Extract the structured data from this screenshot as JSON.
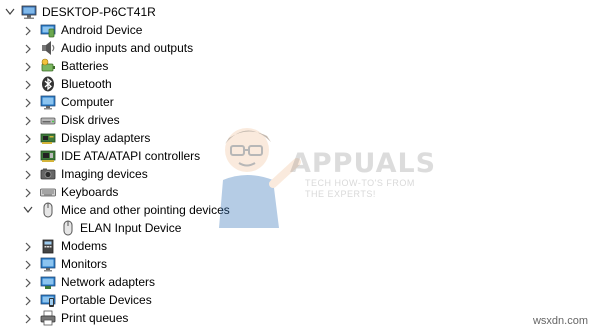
{
  "tree": {
    "root": {
      "label": "DESKTOP-P6CT41R",
      "icon": "computer-root-icon",
      "expanded": true
    },
    "items": [
      {
        "label": "Android Device",
        "icon": "android-device-icon",
        "expanded": false
      },
      {
        "label": "Audio inputs and outputs",
        "icon": "speaker-icon",
        "expanded": false
      },
      {
        "label": "Batteries",
        "icon": "battery-icon",
        "expanded": false
      },
      {
        "label": "Bluetooth",
        "icon": "bluetooth-icon",
        "expanded": false
      },
      {
        "label": "Computer",
        "icon": "monitor-icon",
        "expanded": false
      },
      {
        "label": "Disk drives",
        "icon": "disk-drive-icon",
        "expanded": false
      },
      {
        "label": "Display adapters",
        "icon": "display-adapter-icon",
        "expanded": false
      },
      {
        "label": "IDE ATA/ATAPI controllers",
        "icon": "ide-controller-icon",
        "expanded": false
      },
      {
        "label": "Imaging devices",
        "icon": "camera-icon",
        "expanded": false
      },
      {
        "label": "Keyboards",
        "icon": "keyboard-icon",
        "expanded": false
      },
      {
        "label": "Mice and other pointing devices",
        "icon": "mouse-icon",
        "expanded": true,
        "children": [
          {
            "label": "ELAN Input Device",
            "icon": "mouse-icon"
          }
        ]
      },
      {
        "label": "Modems",
        "icon": "modem-icon",
        "expanded": false
      },
      {
        "label": "Monitors",
        "icon": "monitor-icon",
        "expanded": false
      },
      {
        "label": "Network adapters",
        "icon": "network-adapter-icon",
        "expanded": false
      },
      {
        "label": "Portable Devices",
        "icon": "portable-device-icon",
        "expanded": false
      },
      {
        "label": "Print queues",
        "icon": "printer-icon",
        "expanded": false
      }
    ]
  },
  "watermark": {
    "title": "APPUALS",
    "tagline_1": "TECH HOW-TO'S FROM",
    "tagline_2": "THE EXPERTS!"
  },
  "site_credit": "wsxdn.com"
}
